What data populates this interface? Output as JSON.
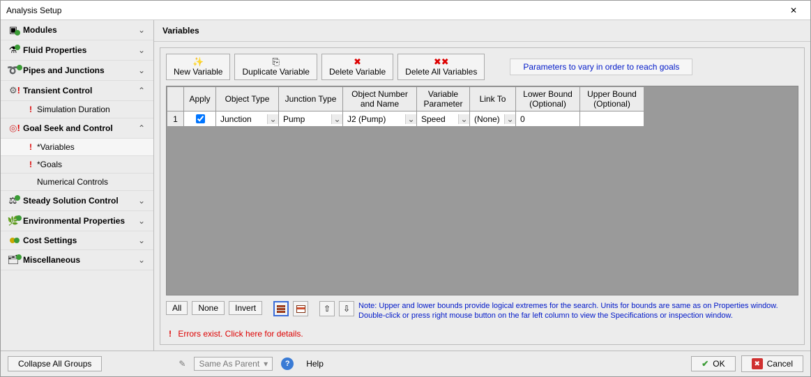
{
  "window": {
    "title": "Analysis Setup",
    "close": "✕"
  },
  "sidebar": {
    "groups": [
      {
        "icon": "module",
        "label": "Modules",
        "chev": "⌄"
      },
      {
        "icon": "flask",
        "label": "Fluid Properties",
        "chev": "⌄"
      },
      {
        "icon": "pipe",
        "label": "Pipes and Junctions",
        "chev": "⌄"
      },
      {
        "icon": "transient",
        "label": "Transient Control",
        "chev": "⌃",
        "items": [
          {
            "bang": true,
            "label": "Simulation Duration"
          }
        ]
      },
      {
        "icon": "goal",
        "label": "Goal Seek and Control",
        "chev": "⌃",
        "items": [
          {
            "bang": true,
            "label": "*Variables",
            "active": true
          },
          {
            "bang": true,
            "label": "*Goals"
          },
          {
            "bang": false,
            "label": "Numerical Controls"
          }
        ]
      },
      {
        "icon": "steady",
        "label": "Steady Solution Control",
        "chev": "⌄"
      },
      {
        "icon": "env",
        "label": "Environmental Properties",
        "chev": "⌄"
      },
      {
        "icon": "cost",
        "label": "Cost Settings",
        "chev": "⌄"
      },
      {
        "icon": "misc",
        "label": "Miscellaneous",
        "chev": "⌄"
      }
    ]
  },
  "panel": {
    "title": "Variables"
  },
  "toolbar": {
    "new": "New Variable",
    "dup": "Duplicate Variable",
    "del": "Delete Variable",
    "delAll": "Delete All Variables",
    "hint": "Parameters to vary in order to reach goals"
  },
  "grid": {
    "headers": {
      "apply": "Apply",
      "objType": "Object Type",
      "jctType": "Junction Type",
      "objNum": "Object Number\nand Name",
      "varParam": "Variable\nParameter",
      "linkTo": "Link To",
      "lower": "Lower Bound\n(Optional)",
      "upper": "Upper Bound\n(Optional)"
    },
    "rows": [
      {
        "num": "1",
        "apply": true,
        "objType": "Junction",
        "jctType": "Pump",
        "objNum": "J2 (Pump)",
        "varParam": "Speed",
        "linkTo": "(None)",
        "lower": "0",
        "upper": ""
      }
    ]
  },
  "below": {
    "all": "All",
    "none": "None",
    "invert": "Invert",
    "note": "Note: Upper and lower bounds provide logical extremes for the search. Units for bounds are same as on Properties window.\nDouble-click or press right mouse button on the far left column to view the Specifications or inspection window."
  },
  "errors": "Errors exist. Click here for details.",
  "footer": {
    "collapse": "Collapse All Groups",
    "sameAsParent": "Same As Parent",
    "help": "Help",
    "ok": "OK",
    "cancel": "Cancel"
  }
}
